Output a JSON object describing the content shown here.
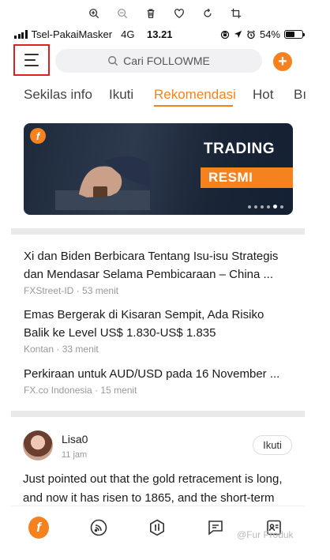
{
  "status_bar": {
    "carrier": "Tsel-PakaiMasker",
    "network": "4G",
    "time": "13.21",
    "battery": "54%",
    "battery_level": 0.54
  },
  "header": {
    "search_placeholder": "Cari FOLLOWME"
  },
  "tabs": [
    {
      "label": "Sekilas info"
    },
    {
      "label": "Ikuti"
    },
    {
      "label": "Rekomendasi"
    },
    {
      "label": "Hot"
    },
    {
      "label": "Bı"
    }
  ],
  "active_tab": "Rekomendasi",
  "banner": {
    "line1": "TRADING",
    "line2": "RESMI",
    "slide_count": 6,
    "active_slide": 1
  },
  "news": [
    {
      "title": "Xi dan Biden Berbicara Tentang Isu-isu Strategis dan Mendasar Selama Pembicaraan – China ...",
      "source": "FXStreet-ID",
      "time": "53 menit"
    },
    {
      "title": "Emas Bergerak di Kisaran Sempit, Ada Risiko Balik ke Level US$ 1.830-US$ 1.835",
      "source": "Kontan",
      "time": "33 menit"
    },
    {
      "title": "Perkiraan untuk AUD/USD pada 16 November ...",
      "source": "FX.co Indonesia",
      "time": "15 menit"
    }
  ],
  "meta_separator": "·",
  "post": {
    "author": "Lisa0",
    "time": "11 jam",
    "follow_label": "Ikuti",
    "body": "Just pointed out that the gold retracement is long, and now it has risen to 1865, and the short-term"
  },
  "nav": {
    "home_glyph": "f"
  },
  "watermark": "@Fur Produk",
  "colors": {
    "accent": "#f5821f",
    "highlight_box": "#e02020"
  }
}
